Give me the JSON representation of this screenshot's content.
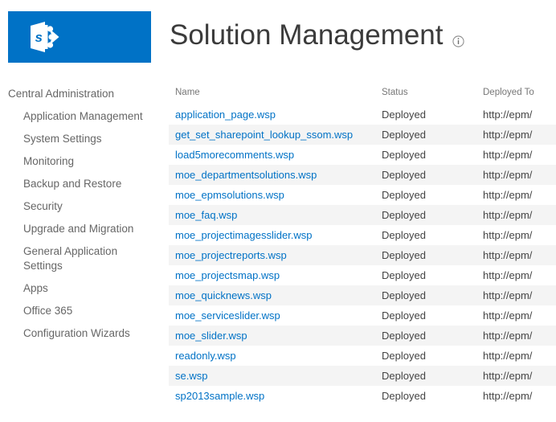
{
  "brand": {
    "logo_icon": "sharepoint-logo-icon",
    "logo_color": "#0072c6",
    "logo_letter": "s"
  },
  "header": {
    "title": "Solution Management",
    "info_icon": "info-icon"
  },
  "sidebar": {
    "title": "Central Administration",
    "items": [
      {
        "label": "Application Management"
      },
      {
        "label": "System Settings"
      },
      {
        "label": "Monitoring"
      },
      {
        "label": "Backup and Restore"
      },
      {
        "label": "Security"
      },
      {
        "label": "Upgrade and Migration"
      },
      {
        "label": "General Application Settings"
      },
      {
        "label": "Apps"
      },
      {
        "label": "Office 365"
      },
      {
        "label": "Configuration Wizards"
      }
    ]
  },
  "table": {
    "columns": [
      "Name",
      "Status",
      "Deployed To"
    ],
    "link_color": "#0072c6",
    "rows": [
      {
        "name": "application_page.wsp",
        "status": "Deployed",
        "deployed_to": "http://epm/"
      },
      {
        "name": "get_set_sharepoint_lookup_ssom.wsp",
        "status": "Deployed",
        "deployed_to": "http://epm/"
      },
      {
        "name": "load5morecomments.wsp",
        "status": "Deployed",
        "deployed_to": "http://epm/"
      },
      {
        "name": "moe_departmentsolutions.wsp",
        "status": "Deployed",
        "deployed_to": "http://epm/"
      },
      {
        "name": "moe_epmsolutions.wsp",
        "status": "Deployed",
        "deployed_to": "http://epm/"
      },
      {
        "name": "moe_faq.wsp",
        "status": "Deployed",
        "deployed_to": "http://epm/"
      },
      {
        "name": "moe_projectimagesslider.wsp",
        "status": "Deployed",
        "deployed_to": "http://epm/"
      },
      {
        "name": "moe_projectreports.wsp",
        "status": "Deployed",
        "deployed_to": "http://epm/"
      },
      {
        "name": "moe_projectsmap.wsp",
        "status": "Deployed",
        "deployed_to": "http://epm/"
      },
      {
        "name": "moe_quicknews.wsp",
        "status": "Deployed",
        "deployed_to": "http://epm/"
      },
      {
        "name": "moe_serviceslider.wsp",
        "status": "Deployed",
        "deployed_to": "http://epm/"
      },
      {
        "name": "moe_slider.wsp",
        "status": "Deployed",
        "deployed_to": "http://epm/"
      },
      {
        "name": "readonly.wsp",
        "status": "Deployed",
        "deployed_to": "http://epm/"
      },
      {
        "name": "se.wsp",
        "status": "Deployed",
        "deployed_to": "http://epm/"
      },
      {
        "name": "sp2013sample.wsp",
        "status": "Deployed",
        "deployed_to": "http://epm/"
      }
    ]
  }
}
